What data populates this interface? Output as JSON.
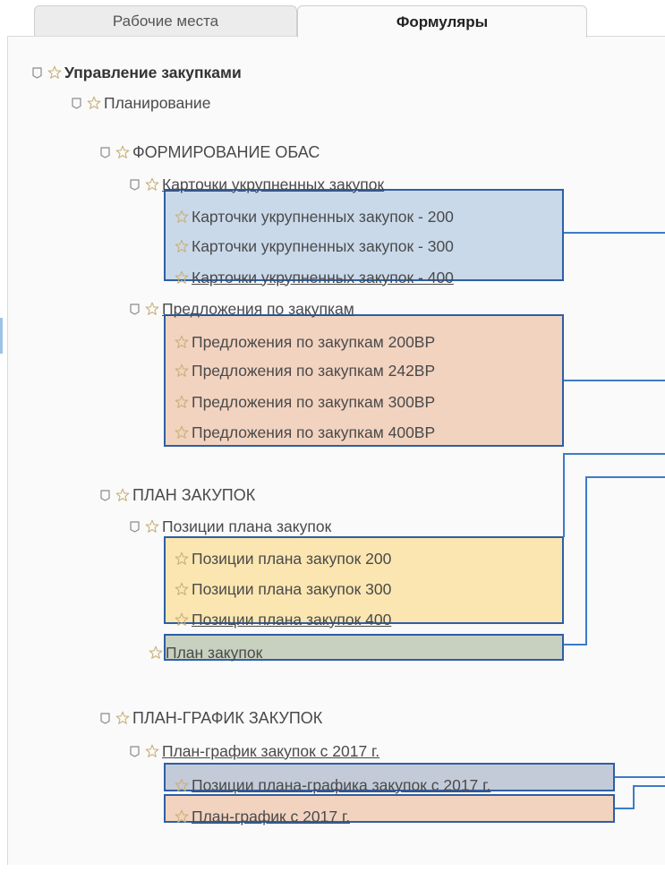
{
  "tabs": [
    {
      "label": "Рабочие места",
      "active": false
    },
    {
      "label": "Формуляры",
      "active": true
    }
  ],
  "tree": {
    "root": "Управление закупками",
    "planning": "Планирование",
    "obas": {
      "title": "ФОРМИРОВАНИЕ ОБАС",
      "cards_group": "Карточки укрупненных закупок",
      "cards": [
        "Карточки укрупненных закупок - 200",
        "Карточки укрупненных закупок - 300",
        "Карточки укрупненных закупок - 400"
      ],
      "proposals_group": "Предложения по закупкам",
      "proposals": [
        "Предложения по закупкам 200ВР",
        "Предложения по закупкам 242ВР",
        "Предложения по закупкам 300ВР",
        "Предложения по закупкам 400ВР"
      ]
    },
    "plan": {
      "title": "ПЛАН ЗАКУПОК",
      "positions_group": "Позиции плана закупок",
      "positions": [
        "Позиции плана закупок 200",
        "Позиции плана закупок 300",
        "Позиции плана закупок 400"
      ],
      "plan_item": "План закупок"
    },
    "schedule": {
      "title": "ПЛАН-ГРАФИК ЗАКУПОК",
      "group": "План-график закупок с 2017 г.",
      "positions": "Позиции плана-графика закупок с 2017 г.",
      "item": "План-график с 2017 г."
    }
  },
  "highlight_colors": {
    "cards": "#c9d9ea",
    "proposals": "#f2d3c0",
    "positions": "#fbe6b1",
    "plan": "#c8d1c0",
    "schedule_positions": "#c3cad8",
    "schedule": "#f2d3c0",
    "border": "#2e5fa5",
    "connector": "#3c7cc7"
  },
  "icons": {
    "doc": "document-icon",
    "star": "star-icon"
  }
}
